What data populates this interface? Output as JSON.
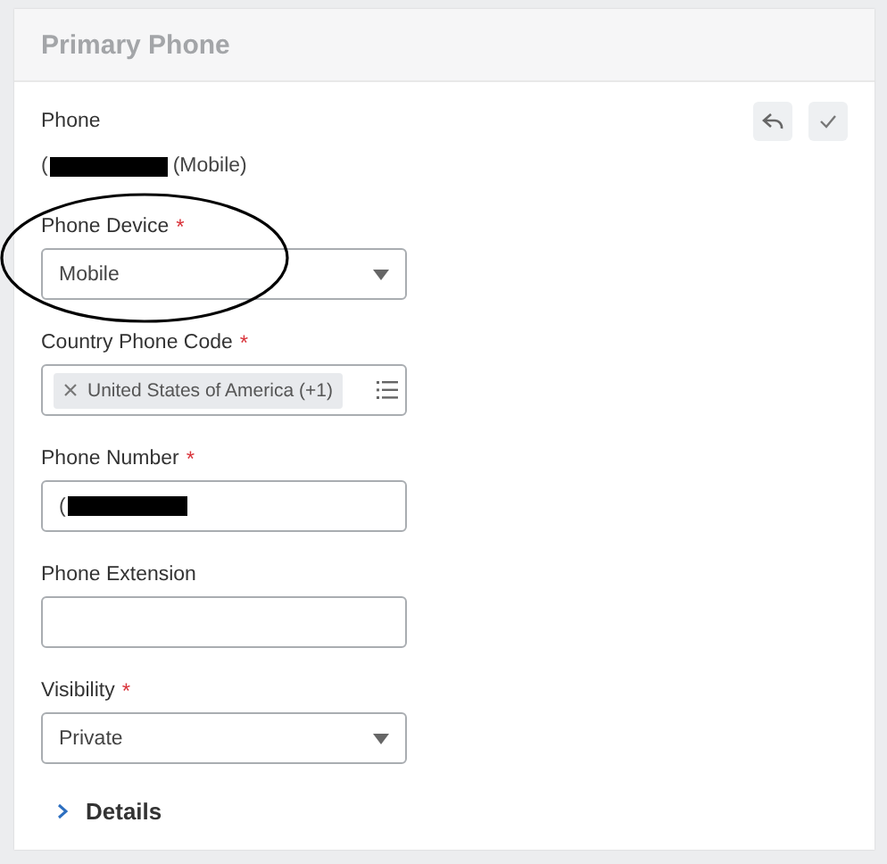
{
  "header": {
    "title": "Primary Phone"
  },
  "actions": [
    {
      "kind": "undo"
    },
    {
      "kind": "confirm"
    }
  ],
  "phone": {
    "label": "Phone",
    "value_prefix": "(",
    "value_suffix": "(Mobile)",
    "redacted": true
  },
  "fields": [
    {
      "kind": "select",
      "label": "Phone Device",
      "marker": "*",
      "value": "Mobile",
      "annotated": true
    },
    {
      "kind": "multiselect",
      "label": "Country Phone Code",
      "marker": "*",
      "tokens": [
        "United States of America (+1)"
      ]
    },
    {
      "kind": "text",
      "label": "Phone Number",
      "marker": "*",
      "value": "(",
      "redacted": true
    },
    {
      "kind": "text",
      "label": "Phone Extension"
    },
    {
      "kind": "select",
      "label": "Visibility",
      "marker": "*",
      "value": "Private"
    }
  ],
  "details": {
    "label": "Details",
    "expanded": false
  }
}
